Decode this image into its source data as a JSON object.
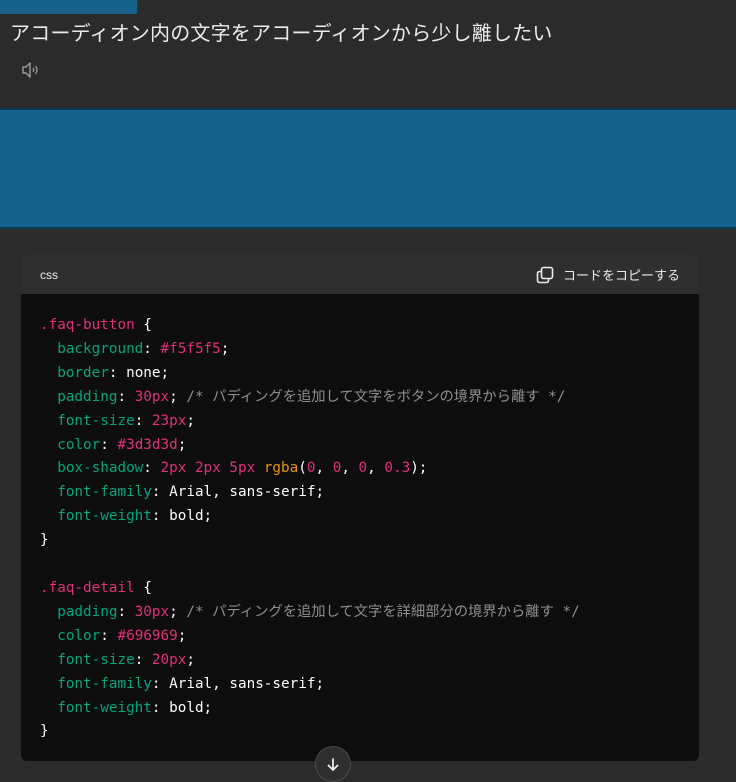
{
  "message": {
    "question": "アコーディオン内の文字をアコーディオンから少し離したい",
    "speaker_icon": "speaker-icon"
  },
  "code_block": {
    "language": "css",
    "copy_label": "コードをコピーする",
    "copy_icon": "copy-icon",
    "selectors": {
      "faq_button": ".faq-button",
      "faq_detail": ".faq-detail"
    },
    "comments": {
      "button_padding": "/* パディングを追加して文字をボタンの境界から離す */",
      "detail_padding": "/* パディングを追加して文字を詳細部分の境界から離す */"
    }
  },
  "scroll_button_icon": "arrow-down-icon",
  "colors": {
    "banner": "#17628a",
    "selector": "#df3079",
    "property": "#00a67d",
    "function": "#e9950c",
    "comment": "#8e8e8e"
  }
}
